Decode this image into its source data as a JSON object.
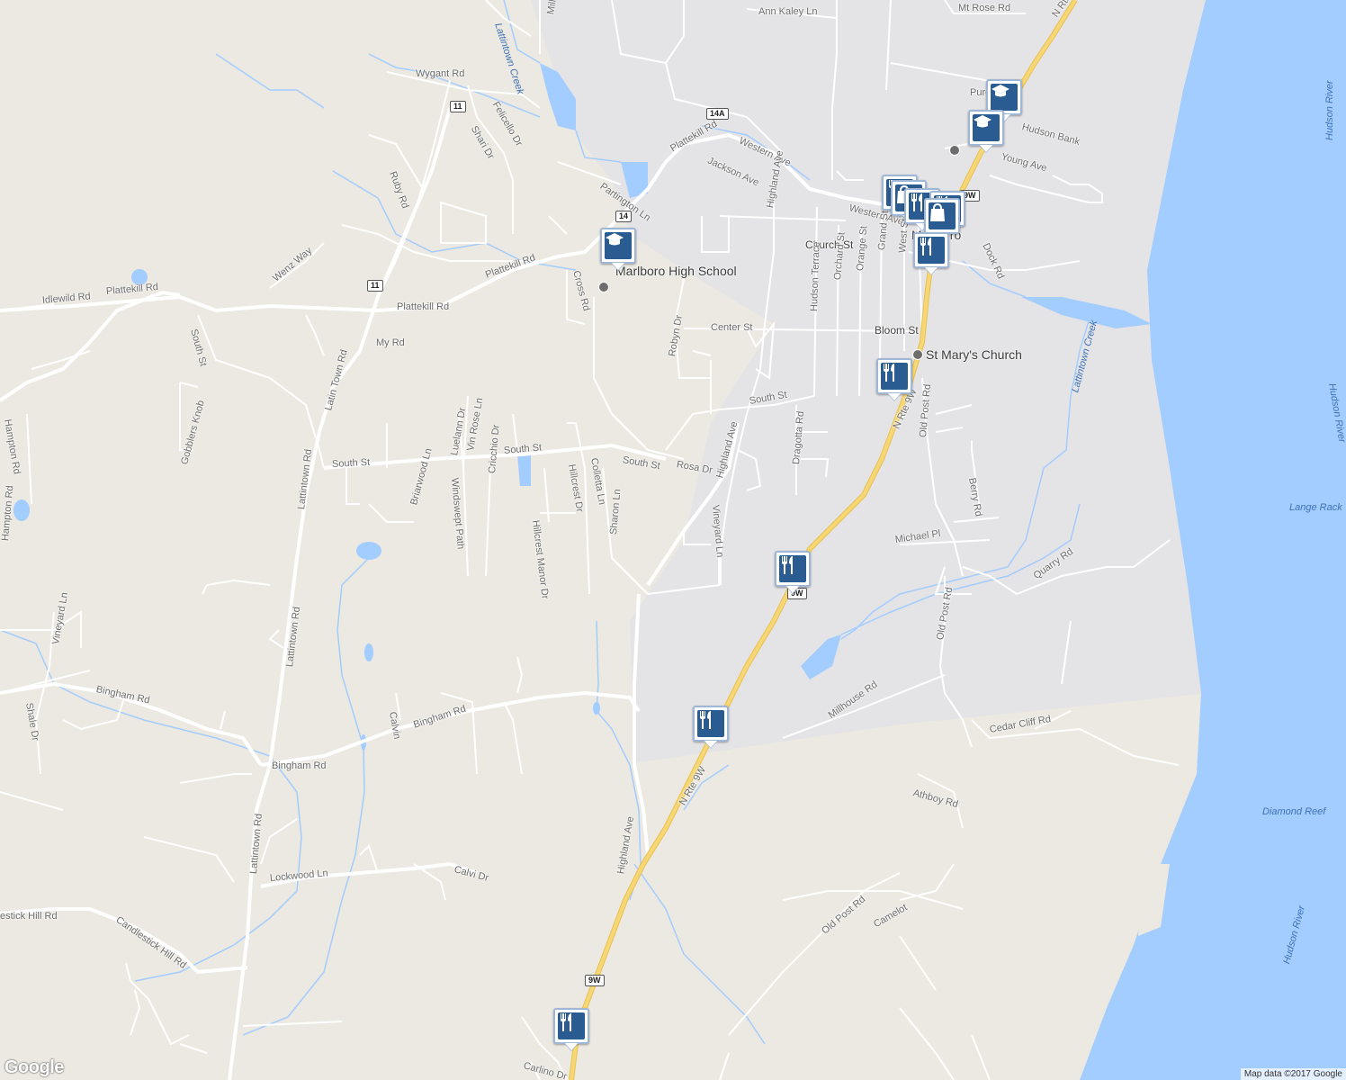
{
  "map": {
    "colors": {
      "land": "#ebe9e1",
      "urban": "#e4e4e6",
      "water": "#a3ccff",
      "road": "#ffffff",
      "highway": "#f7d676",
      "marker_fill": "#2a5b91"
    },
    "place_labels": {
      "town": "Marlboro",
      "school": "Marlboro High School",
      "church": "St Mary's Church"
    },
    "water_labels": {
      "hudson_1": "Hudson River",
      "hudson_2": "Hudson River",
      "hudson_3": "Hudson River",
      "lattintown_creek": "Lattintown Creek",
      "lattintown_creek_top": "Lattintown Creek",
      "lange_rack": "Lange Rack",
      "diamond_reef": "Diamond Reef"
    },
    "road_labels": {
      "mill_pond": "Mill Pond Rd",
      "ann_kaley": "Ann Kaley Ln",
      "mt_rose": "Mt Rose Rd",
      "n_rte_9w_top": "N Rte",
      "wygant": "Wygant Rd",
      "felicello": "Felicello Dr",
      "shari": "Shari Dr",
      "ruby": "Ruby Rd",
      "plattekill_1": "Plattekill Rd",
      "plattekill_2": "Plattekill Rd",
      "plattekill_3": "Plattekill Rd",
      "plattekill_4": "Plattekill Rd",
      "western_1": "Western Ave",
      "western_2": "Western Ave",
      "jackson": "Jackson Ave",
      "partington": "Partington Ln",
      "highland_1": "Highland Ave",
      "highland_2": "Highland Ave",
      "highland_3": "Highland Ave",
      "church_st": "Church St",
      "grand": "Grand St",
      "west_st": "West St",
      "orange": "Orange St",
      "orchard": "Orchard St",
      "hudson_terrace": "Hudson Terrace",
      "dock": "Dock Rd",
      "purdy": "Purd",
      "hudson_bank": "Hudson Bank",
      "young": "Young Ave",
      "idlewild": "Idlewild Rd",
      "wenz": "Wenz Way",
      "cross": "Cross Rd",
      "south_st_1": "South St",
      "south_st_2": "South St",
      "south_st_3": "South St",
      "south_st_4": "South St",
      "south_st_5": "South St",
      "my_rd": "My Rd",
      "latin_town": "Latin Town Rd",
      "robyn": "Robyn Dr",
      "center": "Center St",
      "bloom": "Bloom St",
      "old_post_1": "Old Post Rd",
      "old_post_2": "Old Post Rd",
      "old_post_3": "Old Post Rd",
      "n_rte_9w_1": "N Rte 9W",
      "n_rte_9w_2": "N Rte 9W",
      "hampton_1": "Hampton Rd",
      "hampton_2": "Hampton Rd",
      "gobblers": "Gobblers Knob",
      "luelann": "Luelann Dr",
      "vin_rose": "Vin Rose Ln",
      "rosa": "Rosa Dr",
      "dragotta": "Dragotta Rd",
      "berry": "Berry Rd",
      "lattintown_1": "Lattintown Rd",
      "lattintown_2": "Lattintown Rd",
      "lattintown_3": "Lattintown Rd",
      "briarwood": "Briarwood Ln",
      "windswept": "Windswept Path",
      "cricchio": "Cricchio Dr",
      "hillcrest": "Hillcrest Dr",
      "colletta": "Colletta Ln",
      "hillcrest_manor": "Hillcrest Manor Dr",
      "sharon": "Sharon Ln",
      "vineyard_1": "Vineyard Ln",
      "vineyard_2": "Vineyard Ln",
      "michael": "Michael Pl",
      "quarry": "Quarry Rd",
      "shale": "Shale Dr",
      "bingham_1": "Bingham Rd",
      "bingham_2": "Bingham Rd",
      "bingham_3": "Bingham Rd",
      "calvin": "Calvin",
      "millhouse": "Millhouse Rd",
      "cedar_cliff": "Cedar Cliff Rd",
      "athboy": "Athboy Rd",
      "lockwood": "Lockwood Ln",
      "calvi": "Calvi Dr",
      "candlestick_1": "estick Hill Rd",
      "candlestick_2": "Candlestick Hill Rd",
      "camelot": "Camelot",
      "carlino": "Carlino Dr"
    },
    "shields": {
      "r11a": "11",
      "r11b": "11",
      "r14a": "14A",
      "r14": "14",
      "r9w_a": "9W",
      "r9w_b": "9W",
      "r9w_c": "9W"
    },
    "attribution": "Map data ©2017 Google",
    "logo": "Google"
  }
}
